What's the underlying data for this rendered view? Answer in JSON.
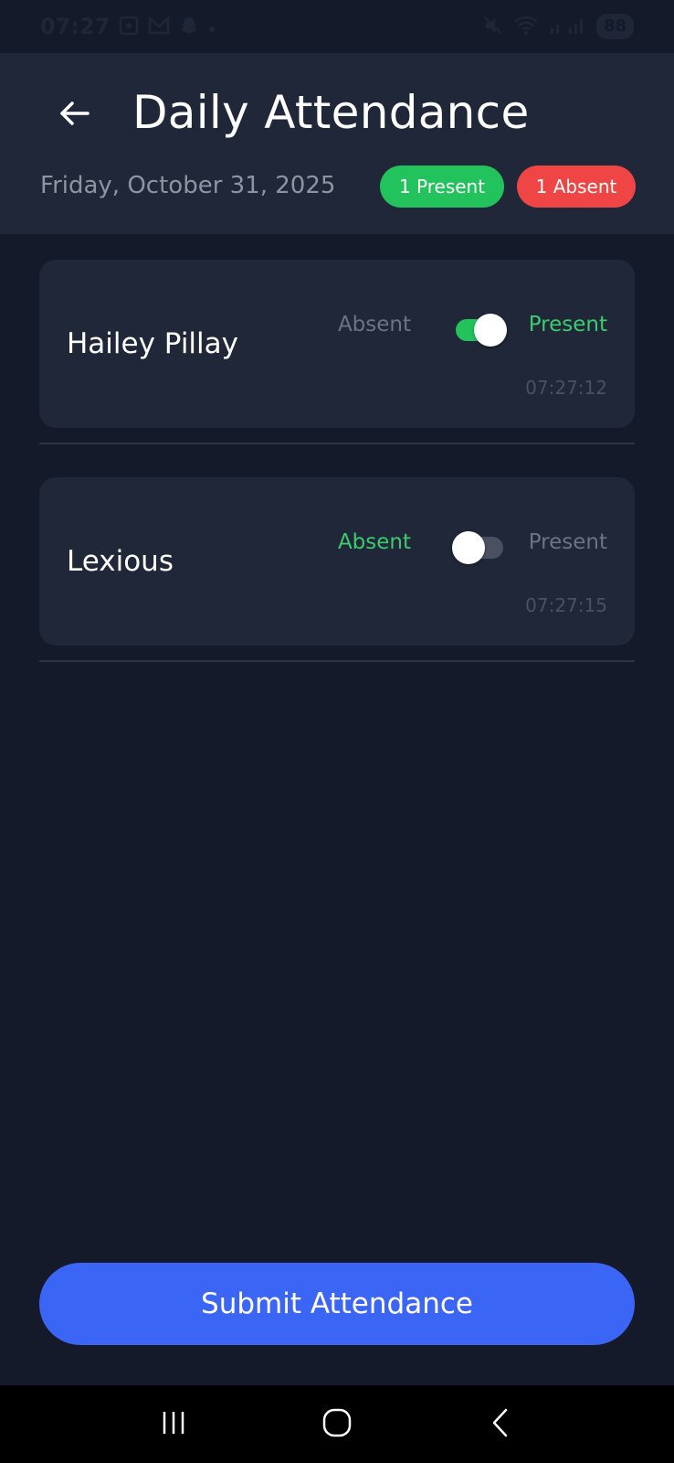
{
  "status_bar": {
    "time": "07:27",
    "battery": "88",
    "icons": [
      "screenshot-icon",
      "gmail-icon",
      "snapchat-icon",
      "dot-icon",
      "mute-icon",
      "wifi-icon",
      "signal-icon"
    ]
  },
  "header": {
    "title": "Daily Attendance",
    "date": "Friday, October 31, 2025",
    "present_badge": "1 Present",
    "absent_badge": "1 Absent"
  },
  "students": [
    {
      "name": "Hailey Pillay",
      "absent_label": "Absent",
      "present_label": "Present",
      "status": "present",
      "time": "07:27:12"
    },
    {
      "name": "Lexious",
      "absent_label": "Absent",
      "present_label": "Present",
      "status": "absent",
      "time": "07:27:15"
    }
  ],
  "submit_label": "Submit Attendance",
  "colors": {
    "background": "#141a29",
    "card": "#1f2738",
    "present": "#22c25d",
    "absent": "#ef4545",
    "accent": "#3b66f5"
  }
}
